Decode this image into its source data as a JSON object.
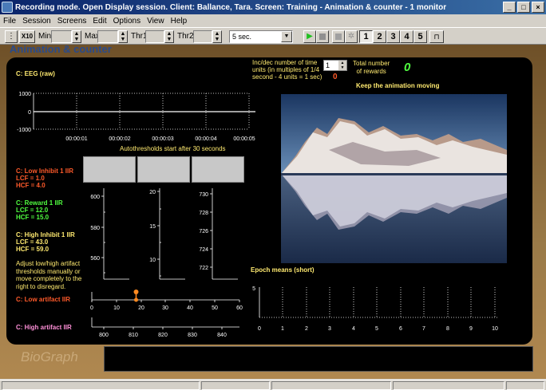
{
  "window": {
    "title": "Recording mode. Open Display session. Client: Ballance, Tara. Screen: Training - Animation & counter - 1 monitor",
    "buttons": [
      "_",
      "□",
      "×"
    ]
  },
  "menu": [
    "File",
    "Session",
    "Screens",
    "Edit",
    "Options",
    "View",
    "Help"
  ],
  "toolbar": {
    "x10_label": "X10",
    "min_label": "Min",
    "max_label": "Max",
    "thr1_label": "Thr1",
    "thr2_label": "Thr2",
    "epoch_dropdown": "5 sec.",
    "monitor_numbers": [
      "1",
      "2",
      "3",
      "4",
      "5"
    ],
    "active_monitor": "1"
  },
  "screen_title": "Animation & counter",
  "eeg": {
    "label": "C: EEG (raw)",
    "y_ticks": [
      "1000",
      "0",
      "-1000"
    ],
    "x_ticks": [
      "00:00:01",
      "00:00:02",
      "00:00:03",
      "00:00:04",
      "00:00:05"
    ],
    "autothreshold_note": "Autothresholds start after 30 seconds"
  },
  "counter": {
    "incdec_text": [
      "Inc/dec number of time",
      "units (in multiples of 1/4",
      "second - 4 units = 1 sec)"
    ],
    "spin_value": "1",
    "incdec_value": "0",
    "total_label": [
      "Total number",
      "of rewards"
    ],
    "total_value": "0"
  },
  "animation_caption": "Keep the animation moving",
  "filters": {
    "low_inhibit": {
      "name": "C: Low Inhibit 1 IIR",
      "lcf": "LCF = 1.0",
      "hcf": "HCF = 4.0"
    },
    "reward": {
      "name": "C: Reward 1 IIR",
      "lcf": "LCF = 12.0",
      "hcf": "HCF = 15.0"
    },
    "high_inhibit": {
      "name": "C: High Inhibit 1 IIR",
      "lcf": "LCF = 43.0",
      "hcf": "HCF = 59.0"
    }
  },
  "bars": {
    "bar1_ticks": [
      "600",
      "580",
      "560"
    ],
    "bar2_ticks": [
      "20",
      "15",
      "10"
    ],
    "bar3_ticks": [
      "730",
      "728",
      "726",
      "724",
      "722"
    ]
  },
  "artifact_note": [
    "Adjust low/high artifact",
    "thresholds manually or",
    "move completely to the",
    "right to disregard."
  ],
  "low_artifact": {
    "label": "C: Low artifact IIR",
    "ticks": [
      "0",
      "10",
      "20",
      "30",
      "40",
      "50",
      "60"
    ],
    "slider_value": 18
  },
  "high_artifact": {
    "label": "C: High artifact IIR",
    "ticks": [
      "800",
      "810",
      "820",
      "830",
      "840"
    ]
  },
  "epoch": {
    "label": "Epoch means (short)",
    "y_ticks": [
      "5",
      "0"
    ],
    "x_ticks": [
      "0",
      "1",
      "2",
      "3",
      "4",
      "5",
      "6",
      "7",
      "8",
      "9",
      "10"
    ]
  },
  "logo_text": "BioGraph",
  "colors": {
    "panel": "#000000",
    "label_yellow": "#ffea70",
    "inhibit_red": "#ff5a2a",
    "reward_green": "#50ff40",
    "artifact_pink": "#ff90d8"
  }
}
